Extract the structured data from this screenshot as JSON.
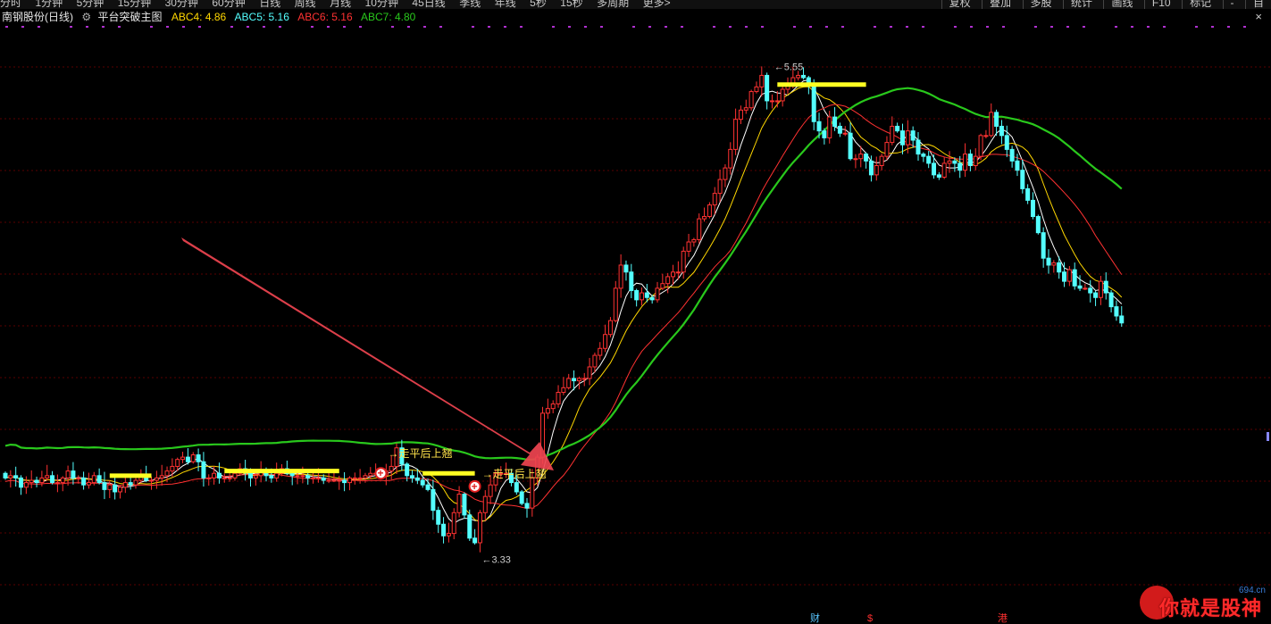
{
  "toolbar": {
    "periods": [
      "分时",
      "1分钟",
      "5分钟",
      "15分钟",
      "30分钟",
      "60分钟",
      "日线",
      "周线",
      "月线",
      "10分钟",
      "45日线",
      "季线",
      "年线",
      "5秒",
      "15秒",
      "多周期",
      "更多>"
    ],
    "tools": [
      "复权",
      "叠加",
      "多股",
      "统计",
      "画线",
      "F10",
      "标记",
      "-",
      "自"
    ]
  },
  "info": {
    "stock_name": "南钢股份(日线)",
    "indicator_name": "平台突破主图",
    "abc4": "ABC4: 4.86",
    "abc5": "ABC5: 5.16",
    "abc6": "ABC6: 5.16",
    "abc7": "ABC7: 4.80",
    "close_icon": "×"
  },
  "chart_data": {
    "type": "candlestick",
    "price_range": [
      3.2,
      5.65
    ],
    "max_label": "5.55",
    "min_label": "3.33",
    "signal_label": "走平后上翘",
    "plus_icon": "+",
    "colors": {
      "up": "#ff3232",
      "down": "#54ffff",
      "ma_green": "#29c81c",
      "ma_yellow": "#ffd700",
      "platform": "#ffff22",
      "grid": "#5a0000",
      "arrow": "#ef4450"
    },
    "open": [
      3.72,
      3.7,
      3.71,
      3.7,
      3.66,
      3.68,
      3.69,
      3.68,
      3.7,
      3.71,
      3.68,
      3.68,
      3.7,
      3.73,
      3.7,
      3.7,
      3.67,
      3.68,
      3.71,
      3.68,
      3.65,
      3.67,
      3.64,
      3.66,
      3.68,
      3.67,
      3.69,
      3.71,
      3.69,
      3.69,
      3.7,
      3.71,
      3.73,
      3.75,
      3.78,
      3.79,
      3.77,
      3.8,
      3.77,
      3.7,
      3.7,
      3.72,
      3.7,
      3.7,
      3.7,
      3.72,
      3.74,
      3.73,
      3.7,
      3.71,
      3.73,
      3.71,
      3.7,
      3.72,
      3.74,
      3.72,
      3.71,
      3.71,
      3.71,
      3.7,
      3.7,
      3.7,
      3.69,
      3.69,
      3.69,
      3.69,
      3.68,
      3.7,
      3.7,
      3.7,
      3.71,
      3.72,
      3.72,
      3.71,
      3.73,
      3.75,
      3.83,
      3.76,
      3.71,
      3.7,
      3.69,
      3.67,
      3.65,
      3.56,
      3.5,
      3.45,
      3.46,
      3.55,
      3.63,
      3.54,
      3.44,
      3.42,
      3.55,
      3.62,
      3.67,
      3.72,
      3.72,
      3.72,
      3.68,
      3.64,
      3.59,
      3.57,
      3.7,
      3.79,
      3.98,
      4.0,
      4.02,
      4.07,
      4.09,
      4.13,
      4.12,
      4.13,
      4.13,
      4.18,
      4.23,
      4.26,
      4.32,
      4.38,
      4.52,
      4.62,
      4.59,
      4.51,
      4.47,
      4.5,
      4.48,
      4.47,
      4.52,
      4.54,
      4.57,
      4.59,
      4.59,
      4.68,
      4.72,
      4.73,
      4.82,
      4.83,
      4.88,
      4.93,
      4.99,
      5.04,
      5.12,
      5.25,
      5.29,
      5.3,
      5.37,
      5.39,
      5.44,
      5.33,
      5.33,
      5.33,
      5.38,
      5.4,
      5.43,
      5.44,
      5.43,
      5.4,
      5.24,
      5.2,
      5.17,
      5.26,
      5.22,
      5.19,
      5.19,
      5.08,
      5.08,
      5.1,
      5.07,
      5.01,
      5.05,
      5.09,
      5.15,
      5.22,
      5.2,
      5.14,
      5.2,
      5.16,
      5.1,
      5.09,
      5.06,
      5.01,
      5.0,
      5.06,
      5.07,
      5.06,
      5.03,
      5.1,
      5.05,
      5.09,
      5.18,
      5.18,
      5.28,
      5.22,
      5.18,
      5.12,
      5.07,
      5.03,
      4.95,
      4.9,
      4.83,
      4.76,
      4.65,
      4.62,
      4.63,
      4.59,
      4.55,
      4.6,
      4.53,
      4.52,
      4.52,
      4.5,
      4.48,
      4.55,
      4.5,
      4.44,
      4.4
    ],
    "close": [
      3.7,
      3.71,
      3.7,
      3.66,
      3.68,
      3.69,
      3.68,
      3.7,
      3.71,
      3.68,
      3.68,
      3.7,
      3.73,
      3.7,
      3.7,
      3.67,
      3.68,
      3.71,
      3.68,
      3.65,
      3.67,
      3.64,
      3.66,
      3.68,
      3.67,
      3.69,
      3.71,
      3.69,
      3.69,
      3.7,
      3.71,
      3.73,
      3.75,
      3.78,
      3.79,
      3.77,
      3.8,
      3.77,
      3.7,
      3.7,
      3.72,
      3.7,
      3.7,
      3.7,
      3.72,
      3.74,
      3.73,
      3.7,
      3.71,
      3.73,
      3.71,
      3.7,
      3.72,
      3.74,
      3.72,
      3.71,
      3.71,
      3.71,
      3.7,
      3.7,
      3.7,
      3.69,
      3.69,
      3.69,
      3.69,
      3.68,
      3.7,
      3.7,
      3.7,
      3.71,
      3.72,
      3.72,
      3.71,
      3.73,
      3.75,
      3.83,
      3.76,
      3.71,
      3.7,
      3.69,
      3.67,
      3.65,
      3.56,
      3.5,
      3.45,
      3.46,
      3.55,
      3.63,
      3.54,
      3.44,
      3.42,
      3.55,
      3.62,
      3.67,
      3.72,
      3.72,
      3.72,
      3.68,
      3.64,
      3.59,
      3.57,
      3.7,
      3.79,
      3.98,
      4.0,
      4.02,
      4.07,
      4.09,
      4.13,
      4.12,
      4.13,
      4.13,
      4.18,
      4.23,
      4.26,
      4.32,
      4.38,
      4.52,
      4.62,
      4.59,
      4.51,
      4.47,
      4.5,
      4.48,
      4.47,
      4.52,
      4.54,
      4.57,
      4.59,
      4.59,
      4.68,
      4.72,
      4.73,
      4.82,
      4.83,
      4.88,
      4.93,
      4.99,
      5.04,
      5.12,
      5.25,
      5.29,
      5.3,
      5.37,
      5.39,
      5.44,
      5.33,
      5.33,
      5.33,
      5.38,
      5.4,
      5.43,
      5.44,
      5.43,
      5.4,
      5.24,
      5.2,
      5.17,
      5.26,
      5.22,
      5.19,
      5.19,
      5.08,
      5.08,
      5.1,
      5.07,
      5.01,
      5.05,
      5.09,
      5.15,
      5.22,
      5.2,
      5.14,
      5.2,
      5.16,
      5.1,
      5.09,
      5.06,
      5.01,
      5.0,
      5.06,
      5.07,
      5.06,
      5.03,
      5.1,
      5.05,
      5.09,
      5.18,
      5.18,
      5.28,
      5.22,
      5.18,
      5.12,
      5.07,
      5.03,
      4.95,
      4.9,
      4.83,
      4.76,
      4.65,
      4.62,
      4.63,
      4.59,
      4.55,
      4.6,
      4.53,
      4.52,
      4.52,
      4.5,
      4.48,
      4.55,
      4.5,
      4.44,
      4.4,
      4.37
    ],
    "platforms": [
      {
        "from": 20,
        "to": 28,
        "value": 3.71
      },
      {
        "from": 42,
        "to": 64,
        "value": 3.73
      },
      {
        "from": 80,
        "to": 90,
        "value": 3.72
      },
      {
        "from": 148,
        "to": 165,
        "value": 5.4
      }
    ],
    "signals": [
      {
        "index": 72,
        "value": 3.72
      },
      {
        "index": 90,
        "value": 3.71
      }
    ]
  },
  "bottom_marks": {
    "cai": "财",
    "s": "$",
    "gang": "港"
  },
  "logo": {
    "text": "你就是股神",
    "site": "694.cn"
  }
}
